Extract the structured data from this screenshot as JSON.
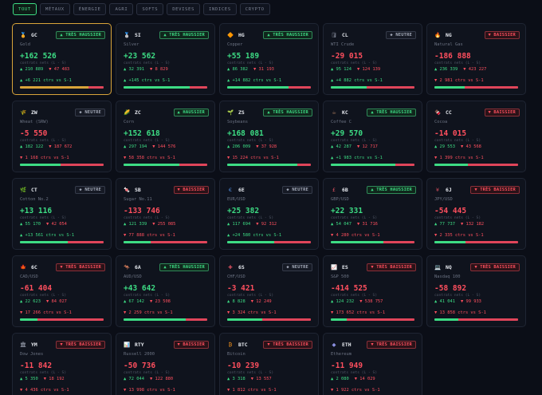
{
  "tabs": [
    {
      "label": "TOUT",
      "active": true
    },
    {
      "label": "MÉTAUX",
      "active": false
    },
    {
      "label": "ÉNERGIE",
      "active": false
    },
    {
      "label": "AGRI",
      "active": false
    },
    {
      "label": "SOFTS",
      "active": false
    },
    {
      "label": "DEVISES",
      "active": false
    },
    {
      "label": "INDICES",
      "active": false
    },
    {
      "label": "CRYPTO",
      "active": false
    }
  ],
  "cards": [
    {
      "code": "GC",
      "icon": "🏅",
      "icon_name": "medal-icon",
      "name": "Gold",
      "badge": "▲ TRÈS HAUSSIER",
      "trend": "up",
      "net": "+162 526",
      "sub": "contrats nets (L - S)",
      "long": "▲ 210 889",
      "short": "▼ 47 483",
      "change": "▲ +6 221 ctrs vs S-1",
      "change_dir": "up",
      "long_share": 0.82,
      "selected": true
    },
    {
      "code": "SI",
      "icon": "🥈",
      "icon_name": "silver-medal-icon",
      "name": "Silver",
      "badge": "▲ TRÈS HAUSSIER",
      "trend": "up",
      "net": "+23 562",
      "sub": "contrats nets (L - S)",
      "long": "▲ 32 391",
      "short": "▼ 8 829",
      "change": "▲ +145 ctrs vs S-1",
      "change_dir": "up",
      "long_share": 0.79
    },
    {
      "code": "HG",
      "icon": "🔶",
      "icon_name": "copper-icon",
      "name": "Copper",
      "badge": "▲ TRÈS HAUSSIER",
      "trend": "up",
      "net": "+55 189",
      "sub": "contrats nets (L - S)",
      "long": "▲ 86 382",
      "short": "▼ 31 193",
      "change": "▲ +14 882 ctrs vs S-1",
      "change_dir": "up",
      "long_share": 0.73
    },
    {
      "code": "CL",
      "icon": "🛢",
      "icon_name": "oil-barrel-icon",
      "name": "WTI Crude",
      "badge": "◆ NEUTRE",
      "trend": "neutral",
      "net": "-29 015",
      "sub": "contrats nets (L - S)",
      "long": "▲ 95 124",
      "short": "▼ 124 139",
      "change": "▲ +4 882 ctrs vs S-1",
      "change_dir": "up",
      "long_share": 0.43
    },
    {
      "code": "NG",
      "icon": "🔥",
      "icon_name": "fire-icon",
      "name": "Natural Gas",
      "badge": "▼ BAISSIER",
      "trend": "down",
      "net": "-186 888",
      "sub": "contrats nets (L - S)",
      "long": "▲ 236 339",
      "short": "▼ 423 227",
      "change": "▼ 2 981 ctrs vs S-1",
      "change_dir": "down",
      "long_share": 0.36
    },
    {
      "code": "ZW",
      "icon": "🌾",
      "icon_name": "wheat-icon",
      "name": "Wheat (SRW)",
      "badge": "◆ NEUTRE",
      "trend": "neutral",
      "net": "-5 550",
      "sub": "contrats nets (L - S)",
      "long": "▲ 182 122",
      "short": "▼ 187 672",
      "change": "▼ 1 168 ctrs vs S-1",
      "change_dir": "down",
      "long_share": 0.49
    },
    {
      "code": "ZC",
      "icon": "🌽",
      "icon_name": "corn-icon",
      "name": "Corn",
      "badge": "▲ HAUSSIER",
      "trend": "up",
      "net": "+152 618",
      "sub": "contrats nets (L - S)",
      "long": "▲ 297 194",
      "short": "▼ 144 576",
      "change": "▼ 58 358 ctrs vs S-1",
      "change_dir": "down",
      "long_share": 0.67
    },
    {
      "code": "ZS",
      "icon": "🌱",
      "icon_name": "soybean-icon",
      "name": "Soybeans",
      "badge": "▲ TRÈS HAUSSIER",
      "trend": "up",
      "net": "+168 081",
      "sub": "contrats nets (L - S)",
      "long": "▲ 206 009",
      "short": "▼ 37 928",
      "change": "▼ 15 224 ctrs vs S-1",
      "change_dir": "down",
      "long_share": 0.84
    },
    {
      "code": "KC",
      "icon": "☕",
      "icon_name": "coffee-icon",
      "name": "Coffee C",
      "badge": "▲ TRÈS HAUSSIER",
      "trend": "up",
      "net": "+29 570",
      "sub": "contrats nets (L - S)",
      "long": "▲ 42 287",
      "short": "▼ 12 717",
      "change": "▲ +1 983 ctrs vs S-1",
      "change_dir": "up",
      "long_share": 0.77
    },
    {
      "code": "CC",
      "icon": "🍫",
      "icon_name": "cocoa-icon",
      "name": "Cocoa",
      "badge": "▼ BAISSIER",
      "trend": "down",
      "net": "-14 015",
      "sub": "contrats nets (L - S)",
      "long": "▲ 29 553",
      "short": "▼ 43 568",
      "change": "▼ 1 399 ctrs vs S-1",
      "change_dir": "down",
      "long_share": 0.4
    },
    {
      "code": "CT",
      "icon": "🌿",
      "icon_name": "cotton-icon",
      "name": "Cotton No.2",
      "badge": "◆ NEUTRE",
      "trend": "neutral",
      "net": "+13 116",
      "sub": "contrats nets (L - S)",
      "long": "▲ 55 170",
      "short": "▼ 42 054",
      "change": "▲ +13 561 ctrs vs S-1",
      "change_dir": "up",
      "long_share": 0.57
    },
    {
      "code": "SB",
      "icon": "🍬",
      "icon_name": "sugar-icon",
      "name": "Sugar No.11",
      "badge": "▼ BAISSIER",
      "trend": "down",
      "net": "-133 746",
      "sub": "contrats nets (L - S)",
      "long": "▲ 121 339",
      "short": "▼ 255 085",
      "change": "▼ 77 888 ctrs vs S-1",
      "change_dir": "down",
      "long_share": 0.32
    },
    {
      "code": "6E",
      "icon": "€",
      "icon_name": "euro-icon",
      "name": "EUR/USD",
      "badge": "◆ NEUTRE",
      "trend": "neutral",
      "net": "+25 382",
      "sub": "contrats nets (L - S)",
      "long": "▲ 117 694",
      "short": "▼ 92 312",
      "change": "▲ +24 580 ctrs vs S-1",
      "change_dir": "up",
      "long_share": 0.56
    },
    {
      "code": "6B",
      "icon": "£",
      "icon_name": "pound-icon",
      "name": "GBP/USD",
      "badge": "▲ TRÈS HAUSSIER",
      "trend": "up",
      "net": "+22 331",
      "sub": "contrats nets (L - S)",
      "long": "▲ 54 047",
      "short": "▼ 31 716",
      "change": "▼ 4 280 ctrs vs S-1",
      "change_dir": "down",
      "long_share": 0.63
    },
    {
      "code": "6J",
      "icon": "¥",
      "icon_name": "yen-icon",
      "name": "JPY/USD",
      "badge": "▼ TRÈS BAISSIER",
      "trend": "down",
      "net": "-54 445",
      "sub": "contrats nets (L - S)",
      "long": "▲ 77 737",
      "short": "▼ 132 182",
      "change": "▼ 2 335 ctrs vs S-1",
      "change_dir": "down",
      "long_share": 0.37
    },
    {
      "code": "6C",
      "icon": "🍁",
      "icon_name": "maple-leaf-icon",
      "name": "CAD/USD",
      "badge": "▼ TRÈS BAISSIER",
      "trend": "down",
      "net": "-61 404",
      "sub": "contrats nets (L - S)",
      "long": "▲ 22 623",
      "short": "▼ 84 027",
      "change": "▼ 17 266 ctrs vs S-1",
      "change_dir": "down",
      "long_share": 0.21
    },
    {
      "code": "6A",
      "icon": "🦘",
      "icon_name": "kangaroo-icon",
      "name": "AUD/USD",
      "badge": "▲ TRÈS HAUSSIER",
      "trend": "up",
      "net": "+43 642",
      "sub": "contrats nets (L - S)",
      "long": "▲ 67 142",
      "short": "▼ 23 508",
      "change": "▼ 2 259 ctrs vs S-1",
      "change_dir": "down",
      "long_share": 0.74
    },
    {
      "code": "6S",
      "icon": "✚",
      "icon_name": "swiss-cross-icon",
      "name": "CHF/USD",
      "badge": "◆ NEUTRE",
      "trend": "neutral",
      "net": "-3 421",
      "sub": "contrats nets (L - S)",
      "long": "▲ 8 828",
      "short": "▼ 12 249",
      "change": "▼ 3 324 ctrs vs S-1",
      "change_dir": "down",
      "long_share": 0.42
    },
    {
      "code": "ES",
      "icon": "📈",
      "icon_name": "chart-up-icon",
      "name": "S&P 500",
      "badge": "▼ TRÈS BAISSIER",
      "trend": "down",
      "net": "-414 525",
      "sub": "contrats nets (L - S)",
      "long": "▲ 124 232",
      "short": "▼ 538 757",
      "change": "▼ 173 652 ctrs vs S-1",
      "change_dir": "down",
      "long_share": 0.19
    },
    {
      "code": "NQ",
      "icon": "💻",
      "icon_name": "laptop-icon",
      "name": "Nasdaq 100",
      "badge": "▼ TRÈS BAISSIER",
      "trend": "down",
      "net": "-58 892",
      "sub": "contrats nets (L - S)",
      "long": "▲ 41 041",
      "short": "▼ 99 933",
      "change": "▼ 13 858 ctrs vs S-1",
      "change_dir": "down",
      "long_share": 0.29
    },
    {
      "code": "YM",
      "icon": "🏛",
      "icon_name": "building-icon",
      "name": "Dow Jones",
      "badge": "▼ TRÈS BAISSIER",
      "trend": "down",
      "net": "-11 842",
      "sub": "contrats nets (L - S)",
      "long": "▲ 5 350",
      "short": "▼ 18 192",
      "change": "▼ 4 436 ctrs vs S-1",
      "change_dir": "down",
      "long_share": 0.23
    },
    {
      "code": "RTY",
      "icon": "📊",
      "icon_name": "bar-chart-icon",
      "name": "Russell 2000",
      "badge": "▼ BAISSIER",
      "trend": "down",
      "net": "-50 736",
      "sub": "contrats nets (L - S)",
      "long": "▲ 72 044",
      "short": "▼ 122 880",
      "change": "▼ 13 998 ctrs vs S-1",
      "change_dir": "down",
      "long_share": 0.37
    },
    {
      "code": "BTC",
      "icon": "₿",
      "icon_name": "bitcoin-icon",
      "name": "Bitcoin",
      "badge": "▼ TRÈS BAISSIER",
      "trend": "down",
      "net": "-10 239",
      "sub": "contrats nets (L - S)",
      "long": "▲ 3 318",
      "short": "▼ 13 557",
      "change": "▼ 1 812 ctrs vs S-1",
      "change_dir": "down",
      "long_share": 0.2
    },
    {
      "code": "ETH",
      "icon": "◆",
      "icon_name": "ethereum-icon",
      "name": "Ethereum",
      "badge": "▼ TRÈS BAISSIER",
      "trend": "down",
      "net": "-11 949",
      "sub": "contrats nets (L - S)",
      "long": "▲ 2 080",
      "short": "▼ 14 029",
      "change": "▼ 1 922 ctrs vs S-1",
      "change_dir": "down",
      "long_share": 0.13
    }
  ]
}
